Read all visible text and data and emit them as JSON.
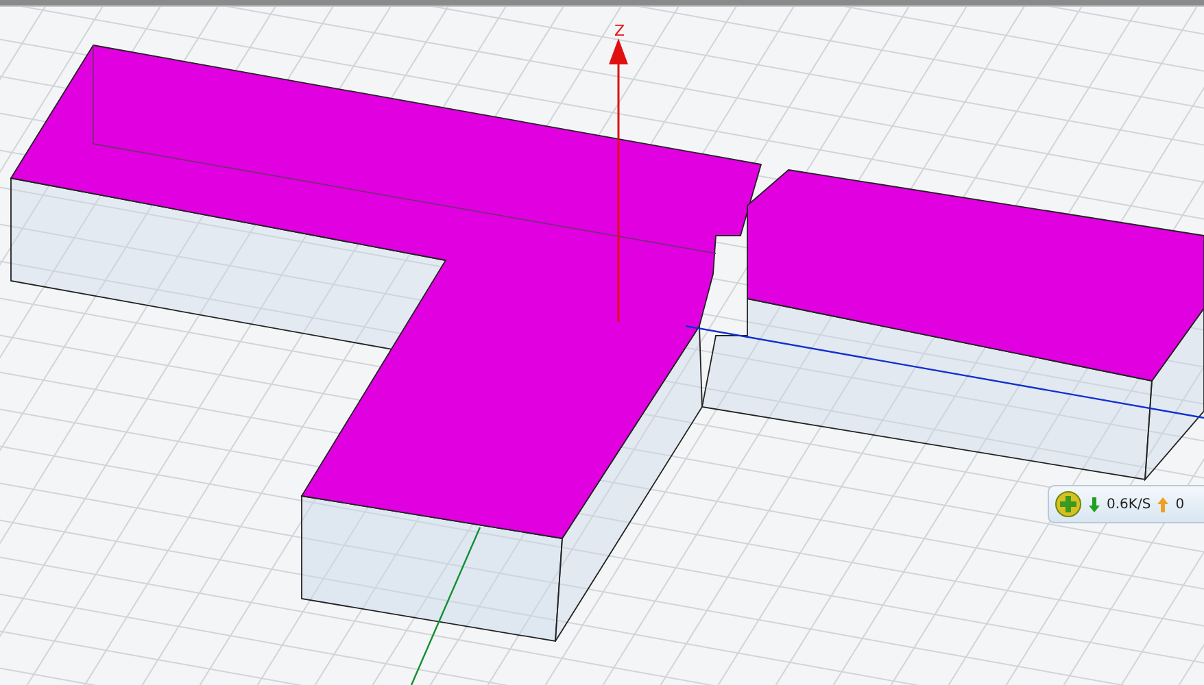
{
  "axis": {
    "label": "Z"
  },
  "speed_widget": {
    "download": "0.6K/S",
    "upload": "0"
  }
}
